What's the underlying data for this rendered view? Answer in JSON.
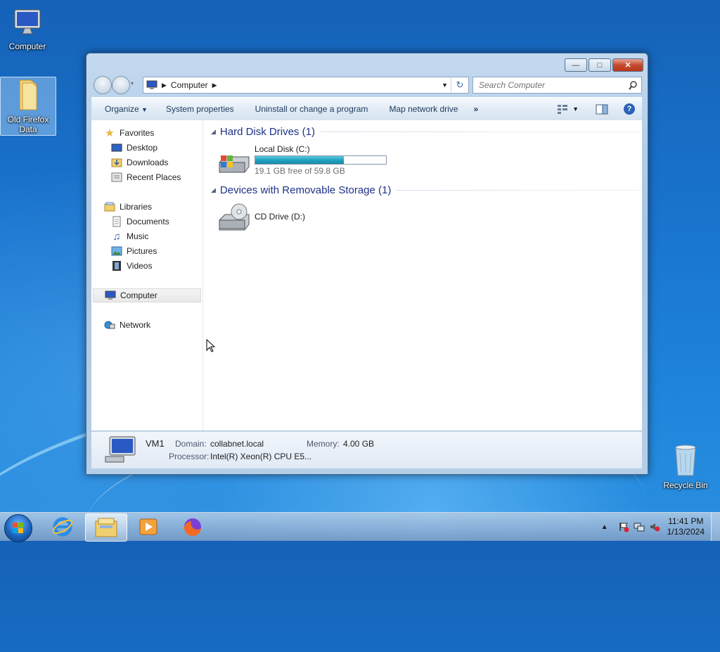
{
  "desktop": {
    "icons": [
      {
        "label": "Computer"
      },
      {
        "label": "Old Firefox Data"
      },
      {
        "label": "Recycle Bin"
      }
    ]
  },
  "window": {
    "address": {
      "crumb": "Computer"
    },
    "search": {
      "placeholder": "Search Computer"
    },
    "toolbar": {
      "organize": "Organize",
      "system_properties": "System properties",
      "uninstall": "Uninstall or change a program",
      "map_drive": "Map network drive",
      "more": "»"
    },
    "nav": {
      "favorites": "Favorites",
      "desktop": "Desktop",
      "downloads": "Downloads",
      "recent": "Recent Places",
      "libraries": "Libraries",
      "documents": "Documents",
      "music": "Music",
      "pictures": "Pictures",
      "videos": "Videos",
      "computer": "Computer",
      "network": "Network"
    },
    "groups": {
      "hdd": {
        "title": "Hard Disk Drives (1)",
        "drive_name": "Local Disk (C:)",
        "drive_free": "19.1 GB free of 59.8 GB",
        "used_fraction": 0.68
      },
      "removable": {
        "title": "Devices with Removable Storage (1)",
        "drive_name": "CD Drive (D:)"
      }
    },
    "details": {
      "name": "VM1",
      "domain_label": "Domain:",
      "domain_value": "collabnet.local",
      "memory_label": "Memory:",
      "memory_value": "4.00 GB",
      "processor_label": "Processor:",
      "processor_value": "Intel(R) Xeon(R) CPU E5..."
    }
  },
  "taskbar": {
    "clock_time": "11:41 PM",
    "clock_date": "1/13/2024"
  },
  "colors": {
    "desktop": "#1a76cf",
    "accent_group": "#1e3287",
    "bar_fill": "#20a2c2"
  }
}
